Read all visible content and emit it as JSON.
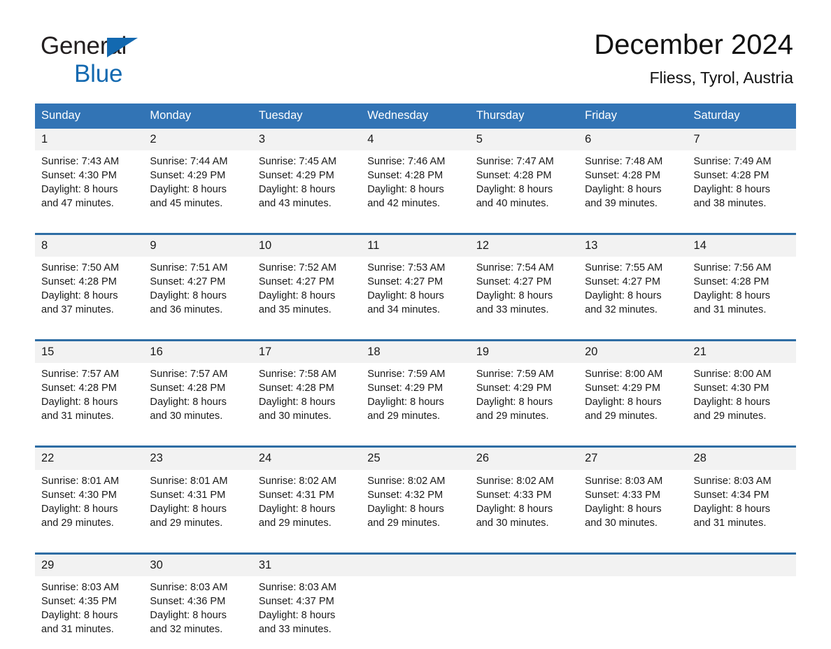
{
  "brand": {
    "name_part1": "General",
    "name_part2": "Blue",
    "triangle_color": "#1369b0"
  },
  "header": {
    "title": "December 2024",
    "subtitle": "Fliess, Tyrol, Austria"
  },
  "colors": {
    "header_blue": "#3274b5",
    "row_rule_blue": "#2e6da4",
    "daynum_band": "#f2f2f2",
    "text": "#1a1a1a"
  },
  "weekdays": [
    "Sunday",
    "Monday",
    "Tuesday",
    "Wednesday",
    "Thursday",
    "Friday",
    "Saturday"
  ],
  "weeks": [
    {
      "days": [
        {
          "date": "1",
          "sunrise": "Sunrise: 7:43 AM",
          "sunset": "Sunset: 4:30 PM",
          "daylight_line1": "Daylight: 8 hours",
          "daylight_line2": "and 47 minutes."
        },
        {
          "date": "2",
          "sunrise": "Sunrise: 7:44 AM",
          "sunset": "Sunset: 4:29 PM",
          "daylight_line1": "Daylight: 8 hours",
          "daylight_line2": "and 45 minutes."
        },
        {
          "date": "3",
          "sunrise": "Sunrise: 7:45 AM",
          "sunset": "Sunset: 4:29 PM",
          "daylight_line1": "Daylight: 8 hours",
          "daylight_line2": "and 43 minutes."
        },
        {
          "date": "4",
          "sunrise": "Sunrise: 7:46 AM",
          "sunset": "Sunset: 4:28 PM",
          "daylight_line1": "Daylight: 8 hours",
          "daylight_line2": "and 42 minutes."
        },
        {
          "date": "5",
          "sunrise": "Sunrise: 7:47 AM",
          "sunset": "Sunset: 4:28 PM",
          "daylight_line1": "Daylight: 8 hours",
          "daylight_line2": "and 40 minutes."
        },
        {
          "date": "6",
          "sunrise": "Sunrise: 7:48 AM",
          "sunset": "Sunset: 4:28 PM",
          "daylight_line1": "Daylight: 8 hours",
          "daylight_line2": "and 39 minutes."
        },
        {
          "date": "7",
          "sunrise": "Sunrise: 7:49 AM",
          "sunset": "Sunset: 4:28 PM",
          "daylight_line1": "Daylight: 8 hours",
          "daylight_line2": "and 38 minutes."
        }
      ]
    },
    {
      "days": [
        {
          "date": "8",
          "sunrise": "Sunrise: 7:50 AM",
          "sunset": "Sunset: 4:28 PM",
          "daylight_line1": "Daylight: 8 hours",
          "daylight_line2": "and 37 minutes."
        },
        {
          "date": "9",
          "sunrise": "Sunrise: 7:51 AM",
          "sunset": "Sunset: 4:27 PM",
          "daylight_line1": "Daylight: 8 hours",
          "daylight_line2": "and 36 minutes."
        },
        {
          "date": "10",
          "sunrise": "Sunrise: 7:52 AM",
          "sunset": "Sunset: 4:27 PM",
          "daylight_line1": "Daylight: 8 hours",
          "daylight_line2": "and 35 minutes."
        },
        {
          "date": "11",
          "sunrise": "Sunrise: 7:53 AM",
          "sunset": "Sunset: 4:27 PM",
          "daylight_line1": "Daylight: 8 hours",
          "daylight_line2": "and 34 minutes."
        },
        {
          "date": "12",
          "sunrise": "Sunrise: 7:54 AM",
          "sunset": "Sunset: 4:27 PM",
          "daylight_line1": "Daylight: 8 hours",
          "daylight_line2": "and 33 minutes."
        },
        {
          "date": "13",
          "sunrise": "Sunrise: 7:55 AM",
          "sunset": "Sunset: 4:27 PM",
          "daylight_line1": "Daylight: 8 hours",
          "daylight_line2": "and 32 minutes."
        },
        {
          "date": "14",
          "sunrise": "Sunrise: 7:56 AM",
          "sunset": "Sunset: 4:28 PM",
          "daylight_line1": "Daylight: 8 hours",
          "daylight_line2": "and 31 minutes."
        }
      ]
    },
    {
      "days": [
        {
          "date": "15",
          "sunrise": "Sunrise: 7:57 AM",
          "sunset": "Sunset: 4:28 PM",
          "daylight_line1": "Daylight: 8 hours",
          "daylight_line2": "and 31 minutes."
        },
        {
          "date": "16",
          "sunrise": "Sunrise: 7:57 AM",
          "sunset": "Sunset: 4:28 PM",
          "daylight_line1": "Daylight: 8 hours",
          "daylight_line2": "and 30 minutes."
        },
        {
          "date": "17",
          "sunrise": "Sunrise: 7:58 AM",
          "sunset": "Sunset: 4:28 PM",
          "daylight_line1": "Daylight: 8 hours",
          "daylight_line2": "and 30 minutes."
        },
        {
          "date": "18",
          "sunrise": "Sunrise: 7:59 AM",
          "sunset": "Sunset: 4:29 PM",
          "daylight_line1": "Daylight: 8 hours",
          "daylight_line2": "and 29 minutes."
        },
        {
          "date": "19",
          "sunrise": "Sunrise: 7:59 AM",
          "sunset": "Sunset: 4:29 PM",
          "daylight_line1": "Daylight: 8 hours",
          "daylight_line2": "and 29 minutes."
        },
        {
          "date": "20",
          "sunrise": "Sunrise: 8:00 AM",
          "sunset": "Sunset: 4:29 PM",
          "daylight_line1": "Daylight: 8 hours",
          "daylight_line2": "and 29 minutes."
        },
        {
          "date": "21",
          "sunrise": "Sunrise: 8:00 AM",
          "sunset": "Sunset: 4:30 PM",
          "daylight_line1": "Daylight: 8 hours",
          "daylight_line2": "and 29 minutes."
        }
      ]
    },
    {
      "days": [
        {
          "date": "22",
          "sunrise": "Sunrise: 8:01 AM",
          "sunset": "Sunset: 4:30 PM",
          "daylight_line1": "Daylight: 8 hours",
          "daylight_line2": "and 29 minutes."
        },
        {
          "date": "23",
          "sunrise": "Sunrise: 8:01 AM",
          "sunset": "Sunset: 4:31 PM",
          "daylight_line1": "Daylight: 8 hours",
          "daylight_line2": "and 29 minutes."
        },
        {
          "date": "24",
          "sunrise": "Sunrise: 8:02 AM",
          "sunset": "Sunset: 4:31 PM",
          "daylight_line1": "Daylight: 8 hours",
          "daylight_line2": "and 29 minutes."
        },
        {
          "date": "25",
          "sunrise": "Sunrise: 8:02 AM",
          "sunset": "Sunset: 4:32 PM",
          "daylight_line1": "Daylight: 8 hours",
          "daylight_line2": "and 29 minutes."
        },
        {
          "date": "26",
          "sunrise": "Sunrise: 8:02 AM",
          "sunset": "Sunset: 4:33 PM",
          "daylight_line1": "Daylight: 8 hours",
          "daylight_line2": "and 30 minutes."
        },
        {
          "date": "27",
          "sunrise": "Sunrise: 8:03 AM",
          "sunset": "Sunset: 4:33 PM",
          "daylight_line1": "Daylight: 8 hours",
          "daylight_line2": "and 30 minutes."
        },
        {
          "date": "28",
          "sunrise": "Sunrise: 8:03 AM",
          "sunset": "Sunset: 4:34 PM",
          "daylight_line1": "Daylight: 8 hours",
          "daylight_line2": "and 31 minutes."
        }
      ]
    },
    {
      "days": [
        {
          "date": "29",
          "sunrise": "Sunrise: 8:03 AM",
          "sunset": "Sunset: 4:35 PM",
          "daylight_line1": "Daylight: 8 hours",
          "daylight_line2": "and 31 minutes."
        },
        {
          "date": "30",
          "sunrise": "Sunrise: 8:03 AM",
          "sunset": "Sunset: 4:36 PM",
          "daylight_line1": "Daylight: 8 hours",
          "daylight_line2": "and 32 minutes."
        },
        {
          "date": "31",
          "sunrise": "Sunrise: 8:03 AM",
          "sunset": "Sunset: 4:37 PM",
          "daylight_line1": "Daylight: 8 hours",
          "daylight_line2": "and 33 minutes."
        },
        {
          "date": "",
          "sunrise": "",
          "sunset": "",
          "daylight_line1": "",
          "daylight_line2": ""
        },
        {
          "date": "",
          "sunrise": "",
          "sunset": "",
          "daylight_line1": "",
          "daylight_line2": ""
        },
        {
          "date": "",
          "sunrise": "",
          "sunset": "",
          "daylight_line1": "",
          "daylight_line2": ""
        },
        {
          "date": "",
          "sunrise": "",
          "sunset": "",
          "daylight_line1": "",
          "daylight_line2": ""
        }
      ]
    }
  ]
}
